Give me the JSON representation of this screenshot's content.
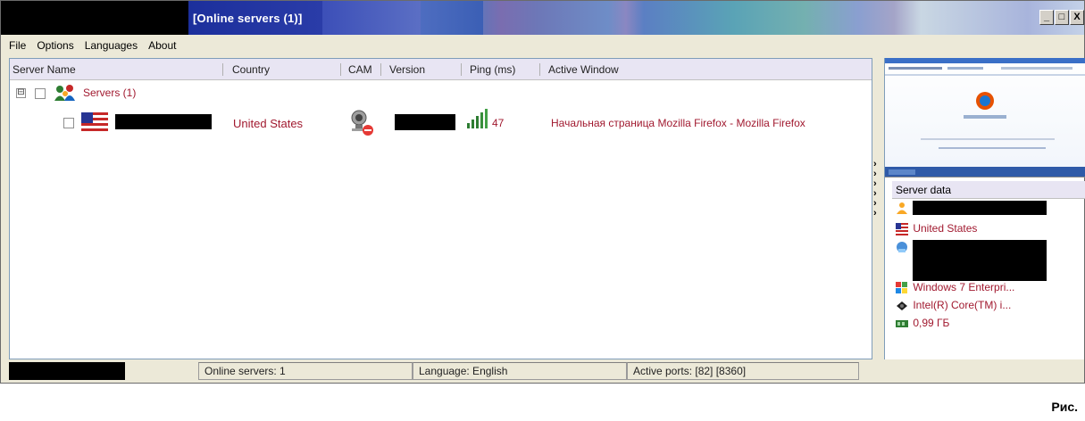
{
  "window": {
    "title": "[Online servers (1)]",
    "buttons": {
      "minimize": "_",
      "maximize": "□",
      "close": "X"
    }
  },
  "menu": [
    "File",
    "Options",
    "Languages",
    "About"
  ],
  "columns": [
    "Server Name",
    "Country",
    "CAM",
    "Version",
    "Ping (ms)",
    "Active Window"
  ],
  "tree": {
    "group_label": "Servers (1)",
    "group_toggle": "⊟",
    "server": {
      "country": "United States",
      "ping": "47",
      "active_window": "Начальная страница Mozilla Firefox - Mozilla Firefox"
    }
  },
  "server_data": {
    "header": "Server data",
    "country": "United States",
    "os": "Windows 7 Enterpri...",
    "cpu": "Intel(R) Core(TM) i...",
    "memory": "0,99 ГБ"
  },
  "arrows": [
    "›",
    "›",
    "›",
    "›",
    "›",
    "›"
  ],
  "status": {
    "online": "Online servers: 1",
    "language": "Language: English",
    "ports": "Active ports:  [82] [8360]"
  },
  "caption": "Рис.",
  "colors": {
    "accent_red": "#a1192f",
    "header_bg": "#e8e5f3",
    "chrome_bg": "#ece9d8"
  }
}
